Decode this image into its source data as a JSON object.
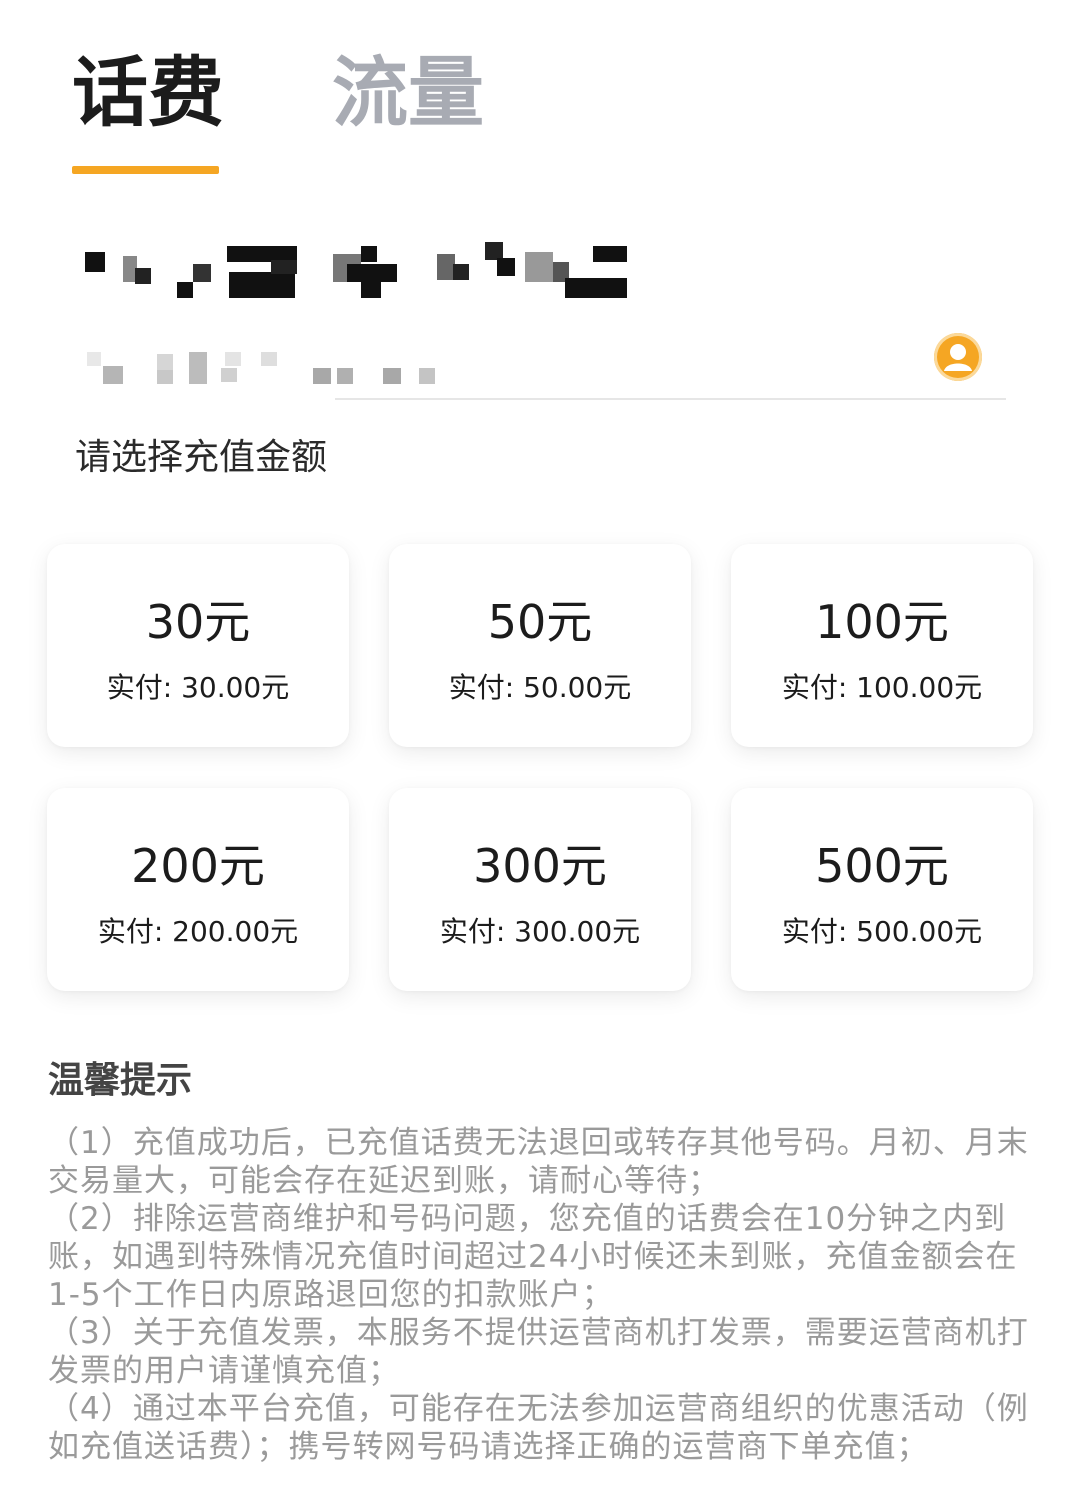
{
  "tabs": [
    {
      "label": "话费",
      "active": true
    },
    {
      "label": "流量",
      "active": false
    }
  ],
  "icons": {
    "contact": "contact-person-icon"
  },
  "section_label": "请选择充值金额",
  "cards": [
    {
      "amount": "30元",
      "paid": "实付: 30.00元"
    },
    {
      "amount": "50元",
      "paid": "实付: 50.00元"
    },
    {
      "amount": "100元",
      "paid": "实付: 100.00元"
    },
    {
      "amount": "200元",
      "paid": "实付: 200.00元"
    },
    {
      "amount": "300元",
      "paid": "实付: 300.00元"
    },
    {
      "amount": "500元",
      "paid": "实付: 500.00元"
    }
  ],
  "tips": {
    "title": "温馨提示",
    "items": [
      "（1）充值成功后，已充值话费无法退回或转存其他号码。月初、月末交易量大，可能会存在延迟到账，请耐心等待；",
      "（2）排除运营商维护和号码问题，您充值的话费会在10分钟之内到账，如遇到特殊情况充值时间超过24小时候还未到账，充值金额会在1-5个工作日内原路退回您的扣款账户；",
      "（3）关于充值发票，本服务不提供运营商机打发票，需要运营商机打发票的用户请谨慎充值；",
      "（4）通过本平台充值，可能存在无法参加运营商组织的优惠活动（例如充值送话费）；携号转网号码请选择正确的运营商下单充值；"
    ]
  },
  "colors": {
    "accent": "#f5a623",
    "tab_active": "#1c1c1c",
    "tab_inactive": "#a8abb3",
    "tips_text": "#9a9a9a"
  }
}
